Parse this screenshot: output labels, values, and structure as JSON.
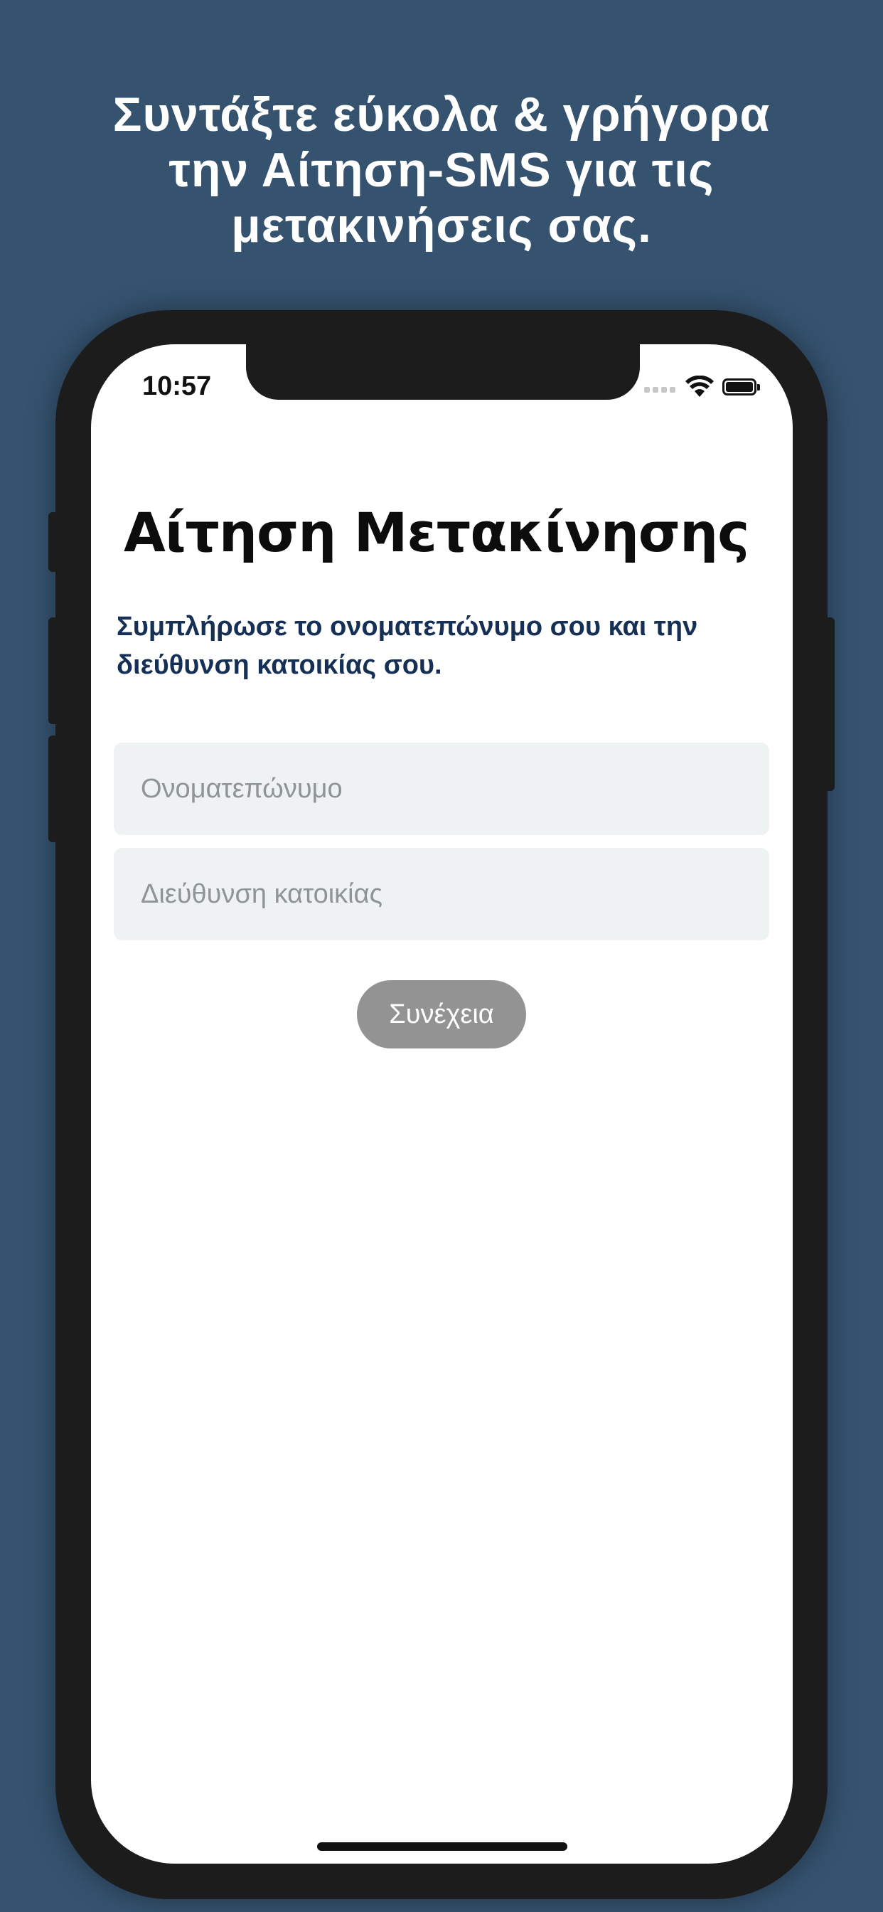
{
  "promo": {
    "line1": "Συντάξτε εύκολα & γρήγορα",
    "line2": "την Αίτηση-SMS για τις",
    "line3": "μετακινήσεις σας."
  },
  "status_bar": {
    "time": "10:57",
    "signal_icon": "cellular-signal-icon",
    "wifi_icon": "wifi-icon",
    "battery_icon": "battery-full-icon"
  },
  "screen": {
    "title": "Αίτηση Μετακίνησης",
    "subtitle": "Συμπλήρωσε το ονοματεπώνυμο σου και την διεύθυνση κατοικίας σου.",
    "name_field": {
      "placeholder": "Ονοματεπώνυμο",
      "value": ""
    },
    "address_field": {
      "placeholder": "Διεύθυνση κατοικίας",
      "value": ""
    },
    "continue_label": "Συνέχεια"
  },
  "colors": {
    "background": "#35526f",
    "subtitle": "#162f54",
    "input_bg": "#eff2f3",
    "button_disabled": "#939393"
  }
}
